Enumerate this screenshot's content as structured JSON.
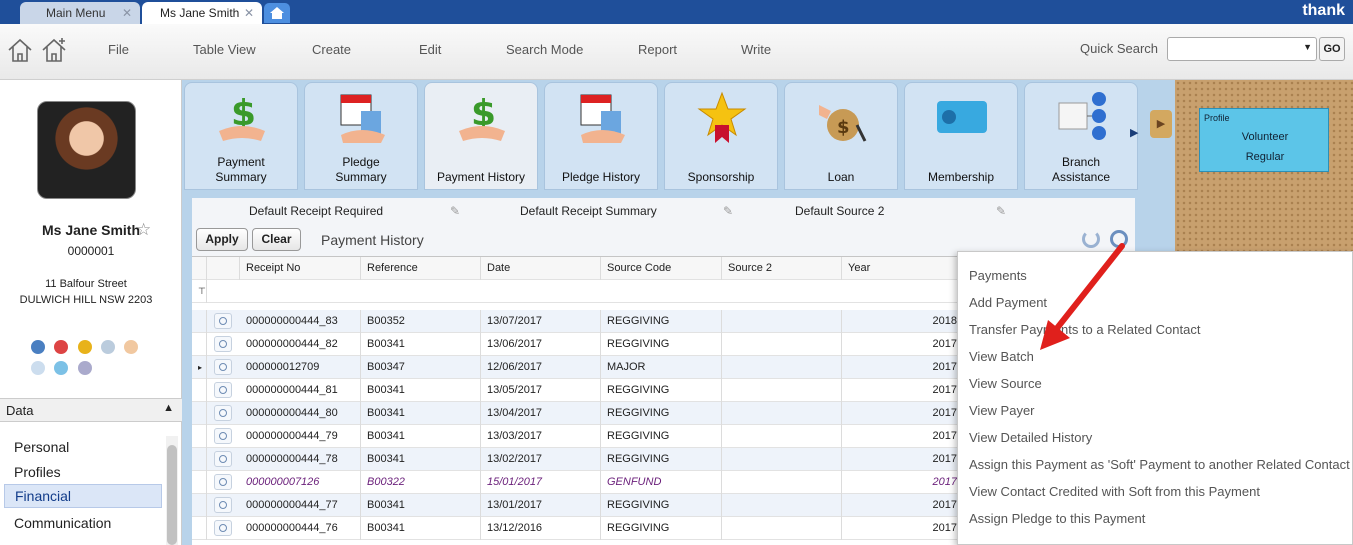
{
  "tabs": [
    {
      "label": "Main Menu",
      "state": "inactive"
    },
    {
      "label": "Ms Jane Smith",
      "state": "active"
    }
  ],
  "brand": "thank",
  "menu": [
    "File",
    "Table View",
    "Create",
    "Edit",
    "Search Mode",
    "Report",
    "Write"
  ],
  "quick_search": {
    "label": "Quick Search",
    "go": "GO",
    "value": ""
  },
  "contact": {
    "name": "Ms Jane Smith",
    "id": "0000001",
    "address_line1": "11 Balfour Street",
    "address_line2": "DULWICH HILL NSW 2203"
  },
  "data_section": {
    "title": "Data",
    "items": [
      "Personal",
      "Profiles",
      "Financial",
      "Communication"
    ],
    "active": "Financial"
  },
  "tiles": [
    {
      "label": "Payment\nSummary",
      "icon": "money-hand-icon"
    },
    {
      "label": "Pledge\nSummary",
      "icon": "calendar-money-icon"
    },
    {
      "label": "Payment History",
      "icon": "money-hand-icon",
      "active": true
    },
    {
      "label": "Pledge History",
      "icon": "calendar-money-icon"
    },
    {
      "label": "Sponsorship",
      "icon": "star-ribbon-icon"
    },
    {
      "label": "Loan",
      "icon": "money-bag-icon"
    },
    {
      "label": "Membership",
      "icon": "membership-card-icon"
    },
    {
      "label": "Branch\nAssistance",
      "icon": "branch-network-icon"
    }
  ],
  "defaults": {
    "receipt": "Default Receipt Required",
    "summary": "Default Receipt Summary",
    "source": "Default Source 2"
  },
  "toolbar": {
    "apply": "Apply",
    "clear": "Clear",
    "title": "Payment History"
  },
  "grid": {
    "columns": [
      "Receipt No",
      "Reference",
      "Date",
      "Source Code",
      "Source 2",
      "Year"
    ],
    "rows": [
      [
        "000000000444_83",
        "B00352",
        "13/07/2017",
        "REGGIVING",
        "",
        "2018"
      ],
      [
        "000000000444_82",
        "B00341",
        "13/06/2017",
        "REGGIVING",
        "",
        "2017"
      ],
      [
        "000000012709",
        "B00347",
        "12/06/2017",
        "MAJOR",
        "",
        "2017"
      ],
      [
        "000000000444_81",
        "B00341",
        "13/05/2017",
        "REGGIVING",
        "",
        "2017"
      ],
      [
        "000000000444_80",
        "B00341",
        "13/04/2017",
        "REGGIVING",
        "",
        "2017"
      ],
      [
        "000000000444_79",
        "B00341",
        "13/03/2017",
        "REGGIVING",
        "",
        "2017"
      ],
      [
        "000000000444_78",
        "B00341",
        "13/02/2017",
        "REGGIVING",
        "",
        "2017"
      ],
      [
        "000000007126",
        "B00322",
        "15/01/2017",
        "GENFUND",
        "",
        "2017"
      ],
      [
        "000000000444_77",
        "B00341",
        "13/01/2017",
        "REGGIVING",
        "",
        "2017"
      ],
      [
        "000000000444_76",
        "B00341",
        "13/12/2016",
        "REGGIVING",
        "",
        "2017"
      ]
    ],
    "italic_row_index": 7
  },
  "profile_card": {
    "label": "Profile",
    "line1": "Volunteer",
    "line2": "Regular"
  },
  "context_menu": [
    "Payments",
    "Add Payment",
    "Transfer Payments to a Related Contact",
    "View Batch",
    "View Source",
    "View Payer",
    "View Detailed History",
    "Assign this Payment as 'Soft' Payment to another Related Contact",
    "View Contact Credited with Soft from this Payment",
    "Assign Pledge to this Payment"
  ],
  "colors": {
    "accent": "#1f4f9a",
    "arrow": "#e0201c",
    "workspace": "#b8d3ea",
    "cork": "#c8a06e"
  }
}
